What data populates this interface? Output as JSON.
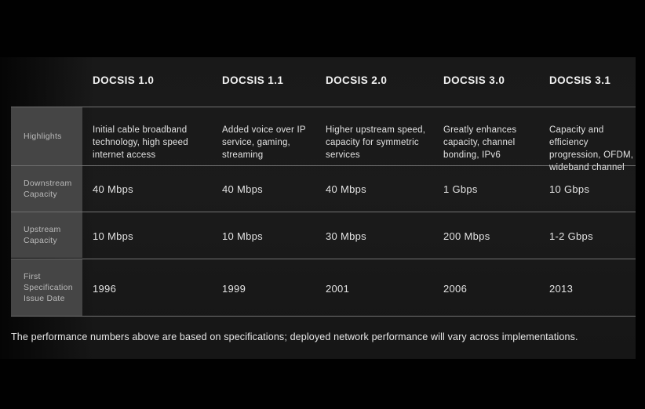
{
  "panel": {
    "background_color": "#1a1a1a",
    "page_background_color": "#000000",
    "label_cell_color": "#454545",
    "separator_color": "#8c8c8c"
  },
  "table": {
    "columns": [
      {
        "label": "DOCSIS 1.0"
      },
      {
        "label": "DOCSIS 1.1"
      },
      {
        "label": "DOCSIS 2.0"
      },
      {
        "label": "DOCSIS 3.0"
      },
      {
        "label": "DOCSIS 3.1"
      }
    ],
    "rows": [
      {
        "label": "Highlights",
        "style": "wrap",
        "values": [
          "Initial cable broadband\ntechnology, high speed\ninternet access",
          "Added voice over IP\nservice, gaming,\nstreaming",
          "Higher upstream speed,\ncapacity for symmetric\nservices",
          "Greatly enhances\ncapacity, channel\nbonding, IPv6",
          "Capacity and efficiency\nprogression, OFDM,\nwideband channel"
        ]
      },
      {
        "label": "Downstream\nCapacity",
        "style": "big",
        "values": [
          "40 Mbps",
          "40 Mbps",
          "40 Mbps",
          "1 Gbps",
          "10 Gbps"
        ]
      },
      {
        "label": "Upstream\nCapacity",
        "style": "big",
        "values": [
          "10 Mbps",
          "10 Mbps",
          "30 Mbps",
          "200 Mbps",
          "1-2 Gbps"
        ]
      },
      {
        "label": "First\nSpecification\nIssue Date",
        "style": "big",
        "values": [
          "1996",
          "1999",
          "2001",
          "2006",
          "2013"
        ]
      }
    ]
  },
  "footnote": {
    "text": "The performance numbers above are based on specifications; deployed network performance will vary across implementations."
  }
}
